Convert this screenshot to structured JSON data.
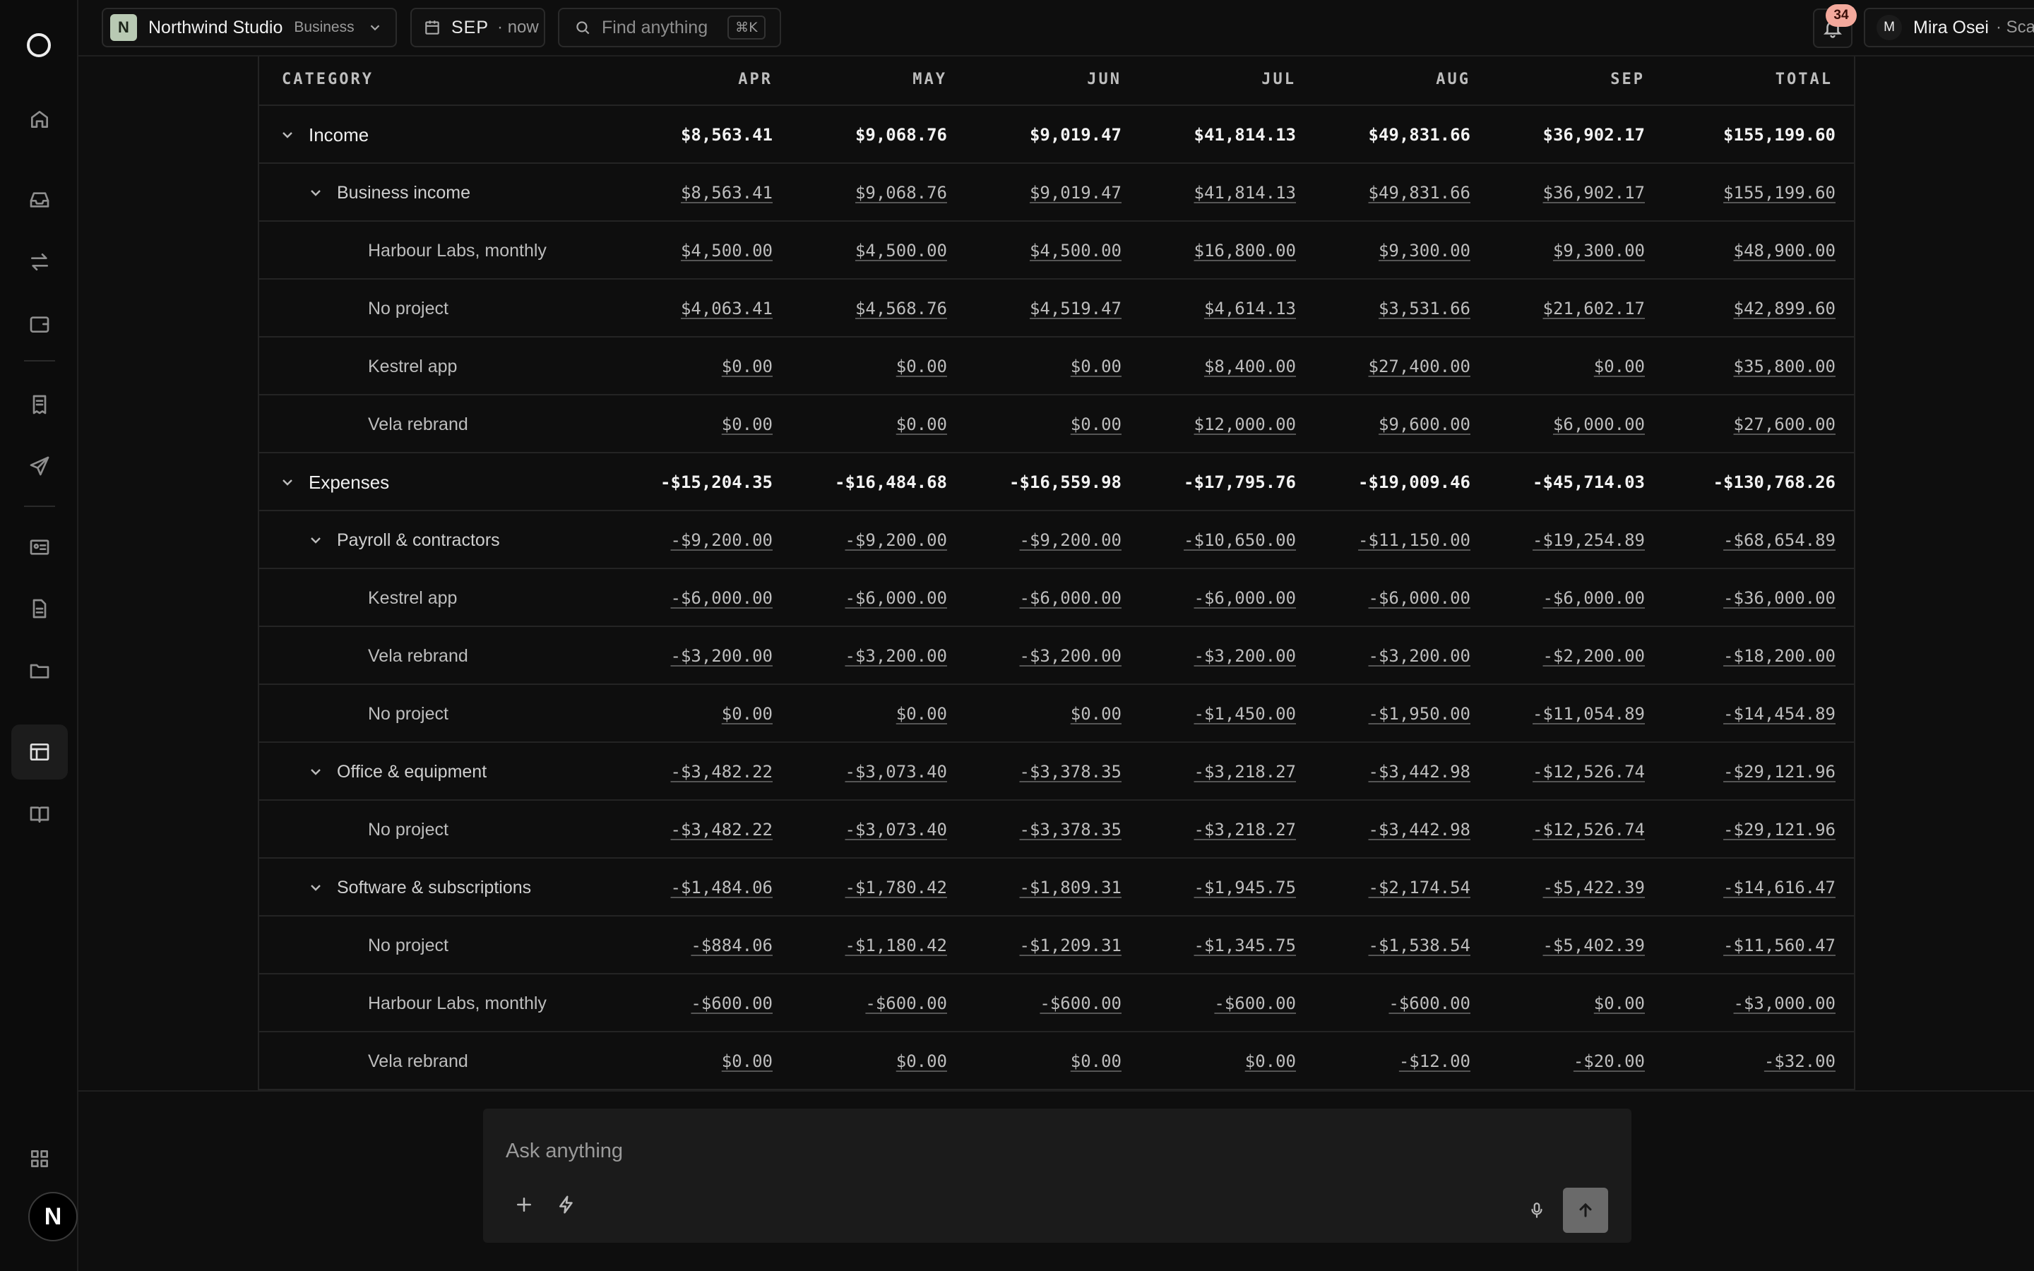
{
  "workspace": {
    "initial": "N",
    "name": "Northwind Studio",
    "plan": "Business"
  },
  "period": {
    "month": "SEP",
    "suffix": "· now"
  },
  "search": {
    "placeholder": "Find anything",
    "shortcut": "⌘K"
  },
  "notifications": {
    "count": "34"
  },
  "user": {
    "initial": "M",
    "name": "Mira Osei",
    "plan": "· Scale"
  },
  "sidebar": {
    "items": [
      {
        "name": "home-icon"
      },
      {
        "name": "inbox-icon"
      },
      {
        "name": "transfer-icon"
      },
      {
        "name": "wallet-icon"
      },
      {
        "name": "invoice-icon"
      },
      {
        "name": "send-icon"
      },
      {
        "name": "contacts-icon"
      },
      {
        "name": "document-icon"
      },
      {
        "name": "folder-icon"
      },
      {
        "name": "table-layout-icon"
      },
      {
        "name": "book-icon"
      },
      {
        "name": "apps-grid-icon"
      }
    ],
    "avatar_initial": "N"
  },
  "table": {
    "headers": [
      "CATEGORY",
      "APR",
      "MAY",
      "JUN",
      "JUL",
      "AUG",
      "SEP",
      "TOTAL"
    ],
    "rows": [
      {
        "level": 0,
        "label": "Income",
        "values": [
          "$8,563.41",
          "$9,068.76",
          "$9,019.47",
          "$41,814.13",
          "$49,831.66",
          "$36,902.17",
          "$155,199.60"
        ]
      },
      {
        "level": 1,
        "label": "Business income",
        "values": [
          "$8,563.41",
          "$9,068.76",
          "$9,019.47",
          "$41,814.13",
          "$49,831.66",
          "$36,902.17",
          "$155,199.60"
        ]
      },
      {
        "level": 2,
        "label": "Harbour Labs, monthly",
        "values": [
          "$4,500.00",
          "$4,500.00",
          "$4,500.00",
          "$16,800.00",
          "$9,300.00",
          "$9,300.00",
          "$48,900.00"
        ]
      },
      {
        "level": 2,
        "label": "No project",
        "values": [
          "$4,063.41",
          "$4,568.76",
          "$4,519.47",
          "$4,614.13",
          "$3,531.66",
          "$21,602.17",
          "$42,899.60"
        ]
      },
      {
        "level": 2,
        "label": "Kestrel app",
        "values": [
          "$0.00",
          "$0.00",
          "$0.00",
          "$8,400.00",
          "$27,400.00",
          "$0.00",
          "$35,800.00"
        ]
      },
      {
        "level": 2,
        "label": "Vela rebrand",
        "values": [
          "$0.00",
          "$0.00",
          "$0.00",
          "$12,000.00",
          "$9,600.00",
          "$6,000.00",
          "$27,600.00"
        ]
      },
      {
        "level": 0,
        "label": "Expenses",
        "values": [
          "-$15,204.35",
          "-$16,484.68",
          "-$16,559.98",
          "-$17,795.76",
          "-$19,009.46",
          "-$45,714.03",
          "-$130,768.26"
        ]
      },
      {
        "level": 1,
        "label": "Payroll & contractors",
        "values": [
          "-$9,200.00",
          "-$9,200.00",
          "-$9,200.00",
          "-$10,650.00",
          "-$11,150.00",
          "-$19,254.89",
          "-$68,654.89"
        ]
      },
      {
        "level": 2,
        "label": "Kestrel app",
        "values": [
          "-$6,000.00",
          "-$6,000.00",
          "-$6,000.00",
          "-$6,000.00",
          "-$6,000.00",
          "-$6,000.00",
          "-$36,000.00"
        ]
      },
      {
        "level": 2,
        "label": "Vela rebrand",
        "values": [
          "-$3,200.00",
          "-$3,200.00",
          "-$3,200.00",
          "-$3,200.00",
          "-$3,200.00",
          "-$2,200.00",
          "-$18,200.00"
        ]
      },
      {
        "level": 2,
        "label": "No project",
        "values": [
          "$0.00",
          "$0.00",
          "$0.00",
          "-$1,450.00",
          "-$1,950.00",
          "-$11,054.89",
          "-$14,454.89"
        ]
      },
      {
        "level": 1,
        "label": "Office & equipment",
        "values": [
          "-$3,482.22",
          "-$3,073.40",
          "-$3,378.35",
          "-$3,218.27",
          "-$3,442.98",
          "-$12,526.74",
          "-$29,121.96"
        ]
      },
      {
        "level": 2,
        "label": "No project",
        "values": [
          "-$3,482.22",
          "-$3,073.40",
          "-$3,378.35",
          "-$3,218.27",
          "-$3,442.98",
          "-$12,526.74",
          "-$29,121.96"
        ]
      },
      {
        "level": 1,
        "label": "Software & subscriptions",
        "values": [
          "-$1,484.06",
          "-$1,780.42",
          "-$1,809.31",
          "-$1,945.75",
          "-$2,174.54",
          "-$5,422.39",
          "-$14,616.47"
        ]
      },
      {
        "level": 2,
        "label": "No project",
        "values": [
          "-$884.06",
          "-$1,180.42",
          "-$1,209.31",
          "-$1,345.75",
          "-$1,538.54",
          "-$5,402.39",
          "-$11,560.47"
        ]
      },
      {
        "level": 2,
        "label": "Harbour Labs, monthly",
        "values": [
          "-$600.00",
          "-$600.00",
          "-$600.00",
          "-$600.00",
          "-$600.00",
          "$0.00",
          "-$3,000.00"
        ]
      },
      {
        "level": 2,
        "label": "Vela rebrand",
        "values": [
          "$0.00",
          "$0.00",
          "$0.00",
          "$0.00",
          "-$12.00",
          "-$20.00",
          "-$32.00"
        ]
      }
    ]
  },
  "composer": {
    "placeholder": "Ask anything"
  },
  "colors": {
    "background": "#0e0e0e",
    "accent_badge": "#f4a99c",
    "workspace_badge": "#b8c9b3"
  }
}
